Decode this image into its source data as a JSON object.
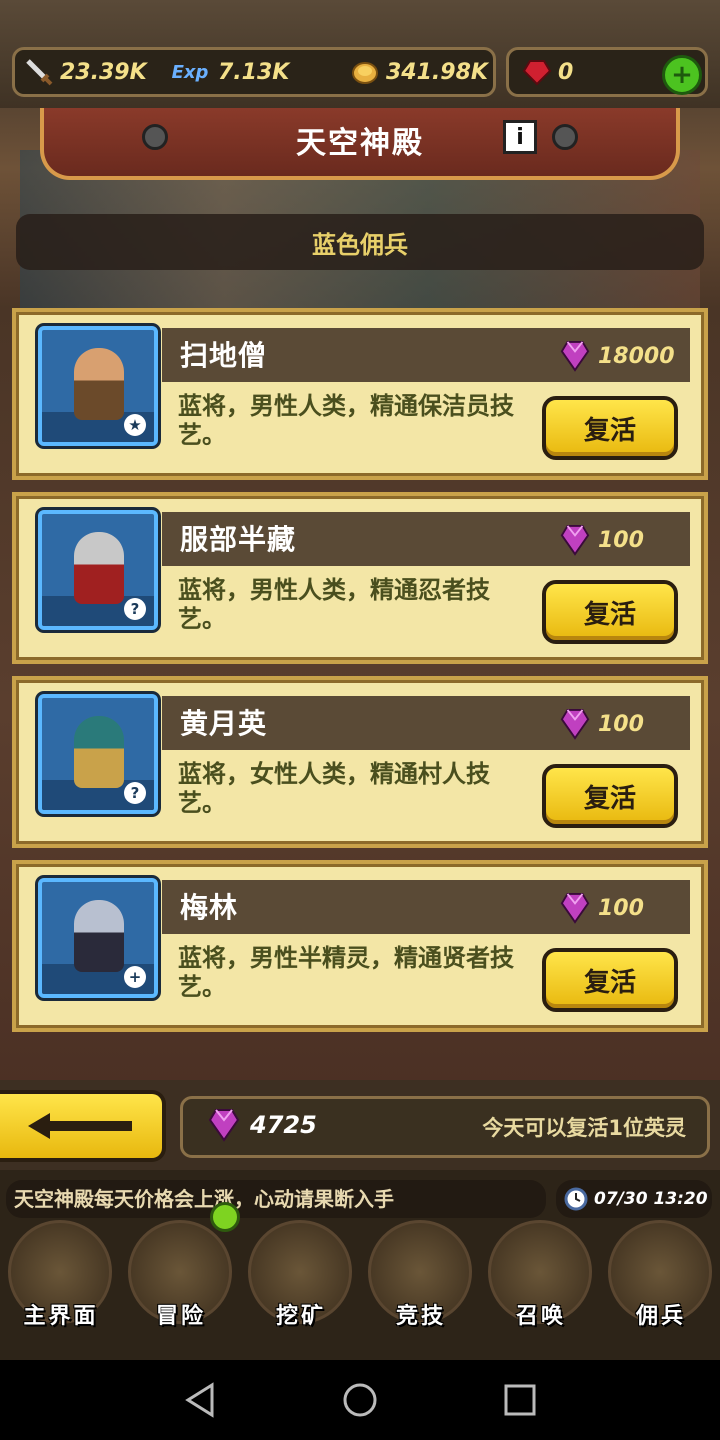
{
  "resources": {
    "attack": {
      "icon": "sword-icon",
      "value": "23.39K"
    },
    "exp": {
      "icon": "exp-icon",
      "value": "7.13K"
    },
    "gold": {
      "icon": "coin-icon",
      "value": "341.98K"
    },
    "ruby": {
      "icon": "ruby-icon",
      "value": "0"
    }
  },
  "header": {
    "title": "天空神殿",
    "info_label": "i"
  },
  "subtitle": "蓝色佣兵",
  "mercenaries": [
    {
      "name": "扫地僧",
      "cost": "18000",
      "desc": "蓝将，男性人类，精通保洁员技艺。",
      "revive_label": "复活",
      "badge": "star",
      "skin": "#d8a070",
      "outfit": "#6b4a2a"
    },
    {
      "name": "服部半藏",
      "cost": "100",
      "desc": "蓝将，男性人类，精通忍者技艺。",
      "revive_label": "复活",
      "badge": "?",
      "skin": "#c8c8c8",
      "outfit": "#a02020"
    },
    {
      "name": "黄月英",
      "cost": "100",
      "desc": "蓝将，女性人类，精通村人技艺。",
      "revive_label": "复活",
      "badge": "?",
      "skin": "#2a7a7a",
      "outfit": "#c9a24a"
    },
    {
      "name": "梅林",
      "cost": "100",
      "desc": "蓝将，男性半精灵，精通贤者技艺。",
      "revive_label": "复活",
      "badge": "+",
      "skin": "#b8c0d0",
      "outfit": "#2a2a3a"
    }
  ],
  "footer": {
    "gems": "4725",
    "revive_note": "今天可以复活1位英灵",
    "ticker": "天空神殿每天价格会上涨，心动请果断入手",
    "time": "07/30 13:20"
  },
  "nav": [
    {
      "label": "主界面",
      "icon": "map-scroll-icon"
    },
    {
      "label": "冒险",
      "icon": "island-icon"
    },
    {
      "label": "挖矿",
      "icon": "pickaxe-icon"
    },
    {
      "label": "竞技",
      "icon": "crossed-swords-icon"
    },
    {
      "label": "召唤",
      "icon": "summon-scroll-icon"
    },
    {
      "label": "佣兵",
      "icon": "tent-icon"
    }
  ],
  "colors": {
    "gold_button": "#f5cd1e",
    "card_bg": "#f3e6a6",
    "gem": "#c040c0"
  }
}
